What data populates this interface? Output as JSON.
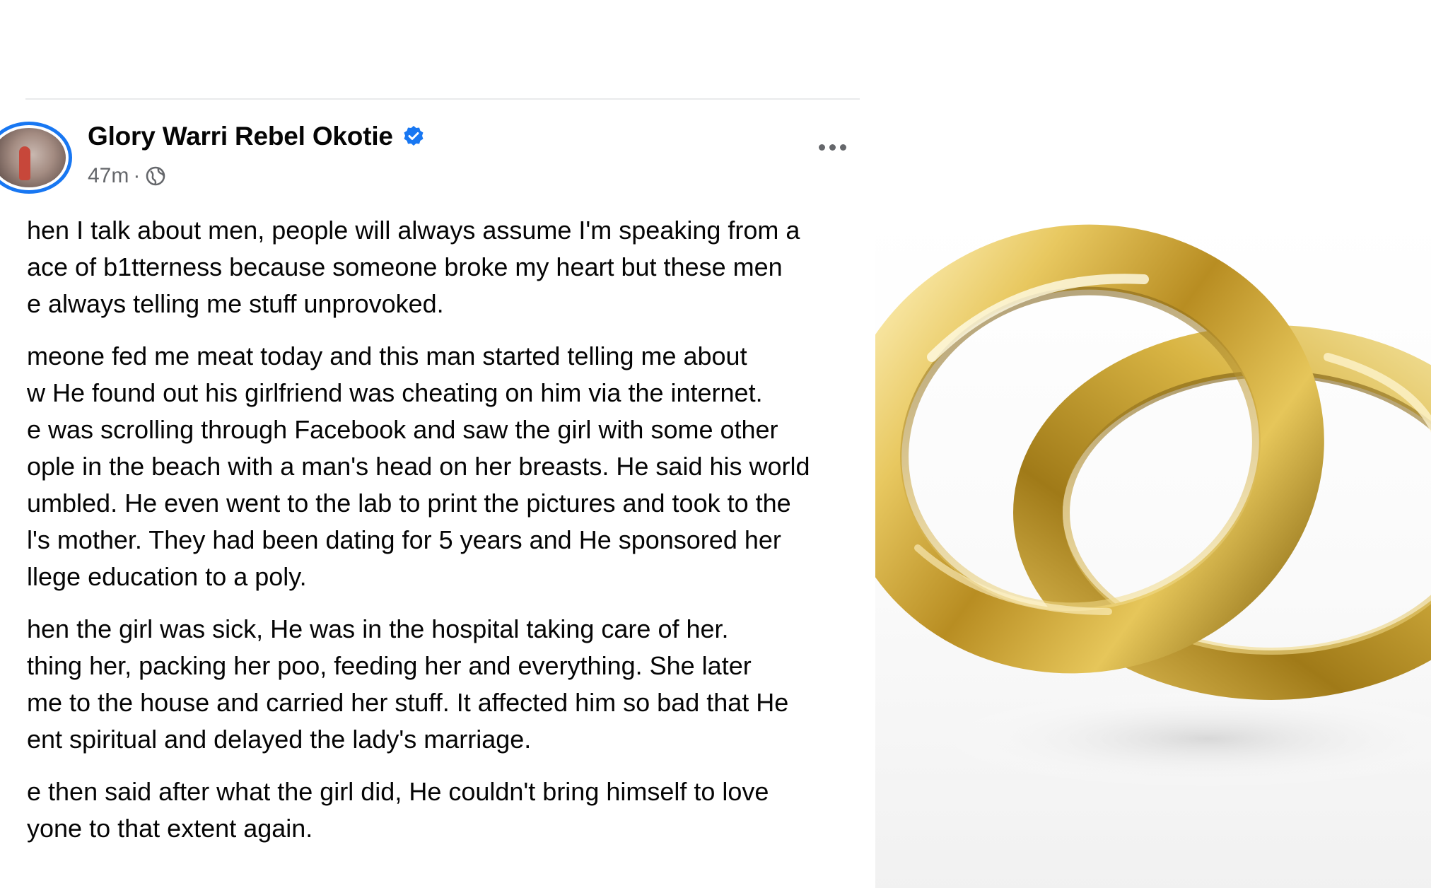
{
  "post": {
    "author": "Glory Warri Rebel Okotie",
    "timestamp": "47m",
    "separator": "·",
    "verified_icon": "verified-badge-icon",
    "audience_icon": "globe-icon",
    "more_icon": "more-options-icon",
    "paragraphs": [
      {
        "lines": [
          "hen I talk about men, people will always assume I'm speaking from a",
          "ace of b1tterness because someone broke my heart but these men",
          "e always telling me stuff unprovoked."
        ]
      },
      {
        "lines": [
          "meone fed me meat today and this man started telling me about",
          "w He found out his girlfriend was cheating on him via the internet.",
          "e was scrolling through Facebook and saw the girl with some other",
          "ople in the beach with a man's head on her breasts. He said his world",
          "umbled. He even went to the lab to print the pictures and took to the",
          "l's mother. They had been dating for 5 years and He sponsored her",
          "llege education to a poly."
        ]
      },
      {
        "lines": [
          "hen the girl was sick, He was in the hospital taking care of her.",
          "thing her, packing her poo, feeding her and everything. She later",
          "me to the house and carried her stuff. It affected him so bad that He",
          "ent spiritual and delayed the lady's marriage."
        ]
      },
      {
        "lines": [
          "e then said after what the girl did, He couldn't bring himself to love",
          "yone to that extent again."
        ]
      }
    ]
  },
  "photo": {
    "subject": "two gold wedding rings",
    "colors": {
      "gold_light": "#f6e7a6",
      "gold_mid": "#d9b544",
      "gold_dark": "#8a6a14",
      "background": "#ffffff"
    }
  },
  "colors": {
    "accent": "#1877f2",
    "text_primary": "#050505",
    "text_secondary": "#65676b",
    "divider": "#e9eaec"
  }
}
